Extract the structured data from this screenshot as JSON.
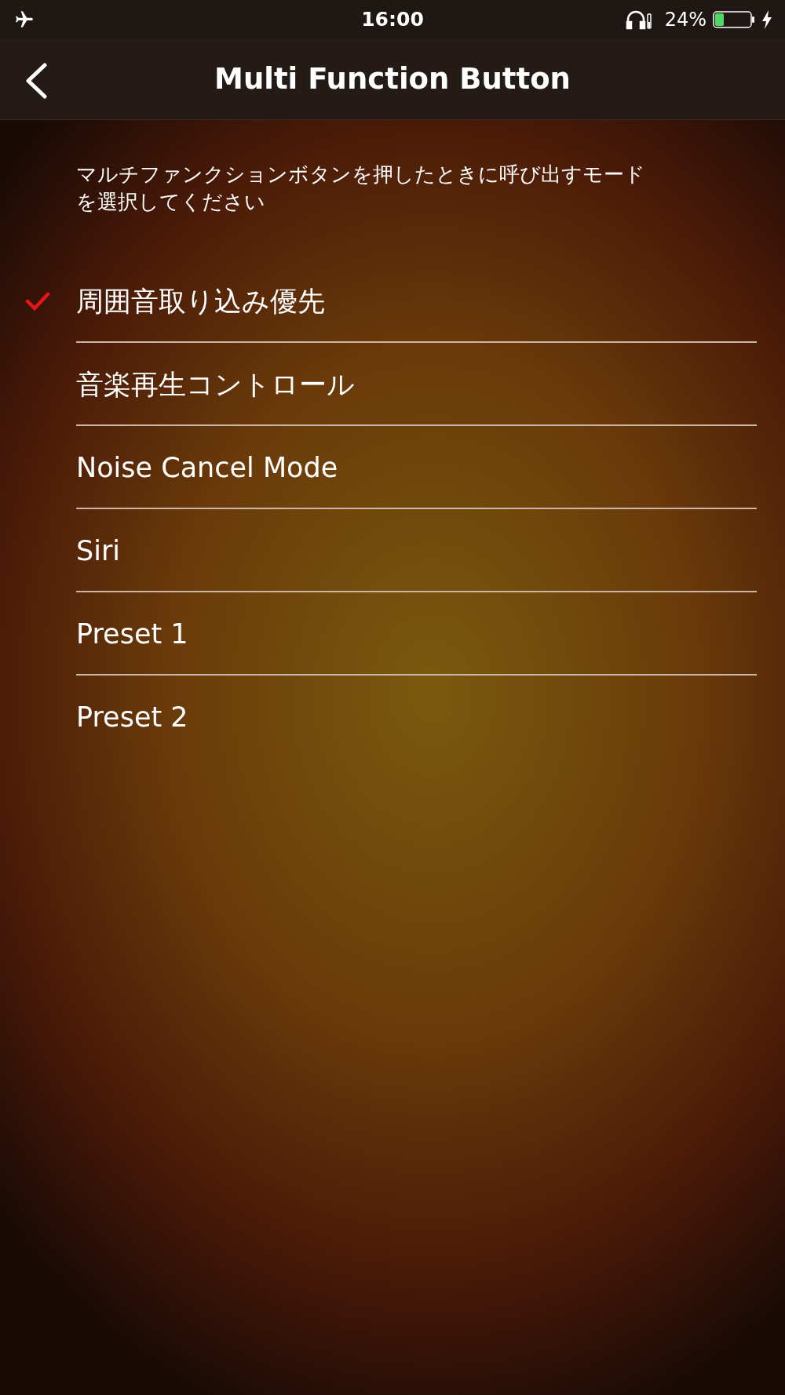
{
  "status_bar": {
    "time": "16:00",
    "battery_percent": "24%",
    "airplane_mode": true,
    "charging": true
  },
  "nav_bar": {
    "title": "Multi Function Button"
  },
  "description": "マルチファンクションボタンを押したときに呼び出すモードを選択してください",
  "options": [
    {
      "label": "周囲音取り込み優先",
      "selected": true
    },
    {
      "label": "音楽再生コントロール",
      "selected": false
    },
    {
      "label": "Noise Cancel Mode",
      "selected": false
    },
    {
      "label": "Siri",
      "selected": false
    },
    {
      "label": "Preset 1",
      "selected": false
    },
    {
      "label": "Preset 2",
      "selected": false
    }
  ]
}
